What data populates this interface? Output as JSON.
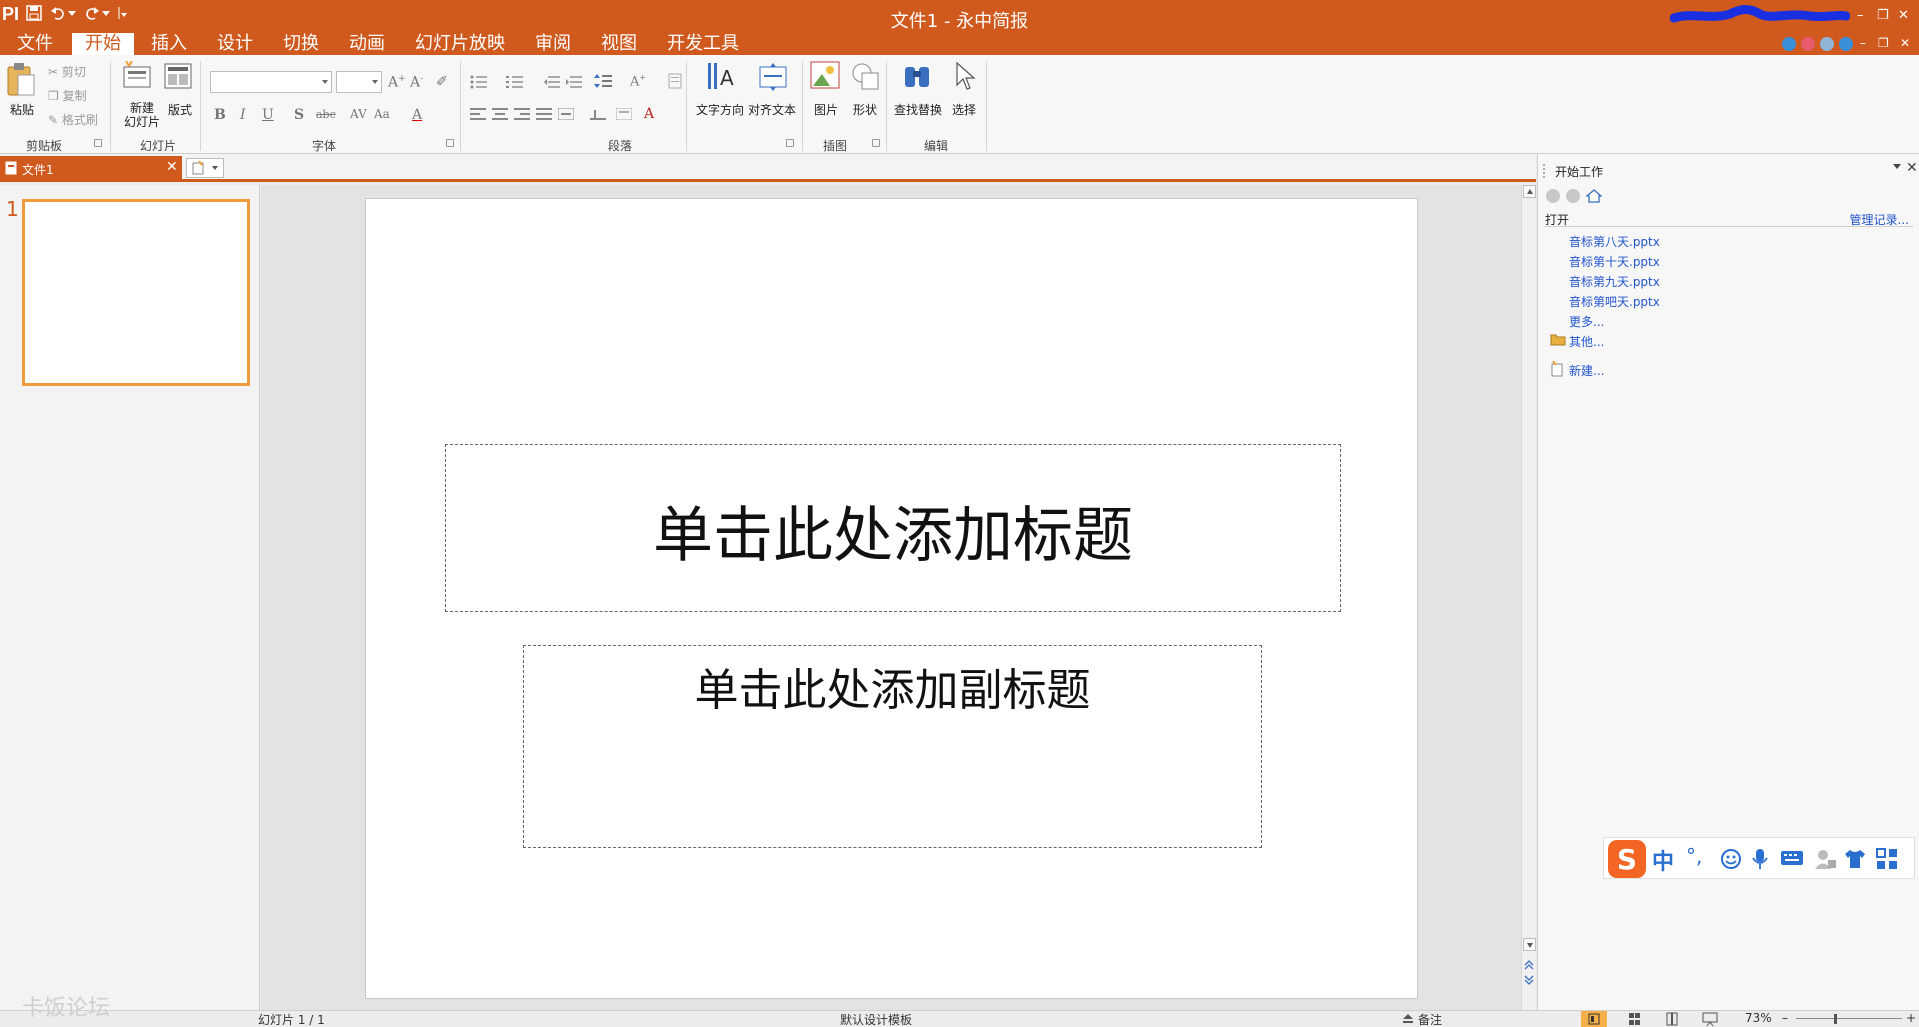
{
  "window": {
    "title": "文件1 - 永中简报",
    "app_logo": "PI",
    "controls": {
      "minimize": "–",
      "restore": "❐",
      "close": "✕"
    }
  },
  "menu": {
    "tabs": [
      {
        "label": "文件"
      },
      {
        "label": "开始",
        "active": true
      },
      {
        "label": "插入"
      },
      {
        "label": "设计"
      },
      {
        "label": "切换"
      },
      {
        "label": "动画"
      },
      {
        "label": "幻灯片放映"
      },
      {
        "label": "审阅"
      },
      {
        "label": "视图"
      },
      {
        "label": "开发工具"
      }
    ]
  },
  "ribbon": {
    "clipboard": {
      "group_label": "剪贴板",
      "paste": "粘贴",
      "cut": "剪切",
      "copy": "复制",
      "format_painter": "格式刷"
    },
    "slides": {
      "group_label": "幻灯片",
      "new_slide_line1": "新建",
      "new_slide_line2": "幻灯片",
      "layout": "版式"
    },
    "font": {
      "group_label": "字体"
    },
    "paragraph": {
      "group_label": "段落"
    },
    "text": {
      "text_direction": "文字方向",
      "align_text": "对齐文本"
    },
    "illustrations": {
      "group_label": "插图",
      "picture": "图片",
      "shapes": "形状"
    },
    "editing": {
      "group_label": "编辑",
      "find_replace": "查找替换",
      "select": "选择"
    }
  },
  "doc_tabs": {
    "active_tab": "文件1",
    "close": "✕"
  },
  "thumbnails": {
    "slides": [
      {
        "number": "1"
      }
    ]
  },
  "slide": {
    "title_placeholder": "单击此处添加标题",
    "subtitle_placeholder": "单击此处添加副标题"
  },
  "task_pane": {
    "title": "开始工作",
    "open_label": "打开",
    "manage_label": "管理记录...",
    "recent_files": [
      "音标第八天.pptx",
      "音标第十天.pptx",
      "音标第九天.pptx",
      "音标第吧天.pptx"
    ],
    "more_label": "更多...",
    "other_label": "其他...",
    "new_label": "新建..."
  },
  "ime": {
    "mode": "中",
    "punct": "°,"
  },
  "status": {
    "watermark": "卡饭论坛",
    "slide_position": "幻灯片 1 / 1",
    "template": "默认设计模板",
    "notes": "备注",
    "zoom": "73%",
    "zoom_level": 0.73
  },
  "colors": {
    "accent": "#d05a1e",
    "thumb_border": "#f39a3a",
    "link": "#2255cc"
  }
}
